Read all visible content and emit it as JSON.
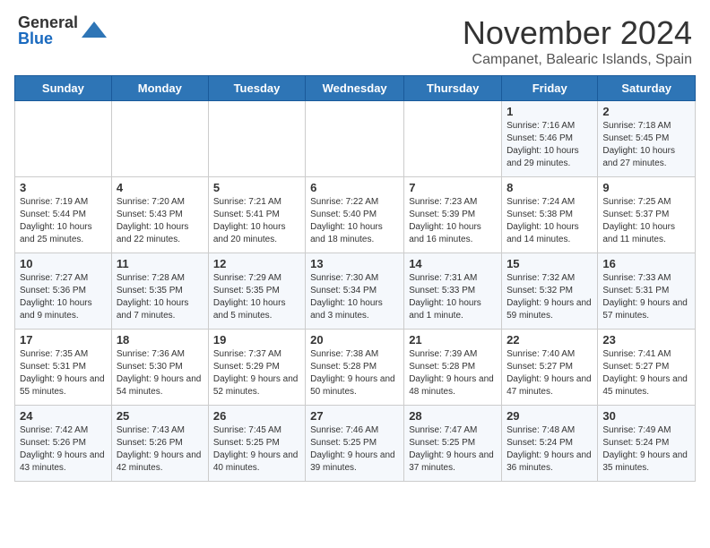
{
  "header": {
    "logo_general": "General",
    "logo_blue": "Blue",
    "month_title": "November 2024",
    "location": "Campanet, Balearic Islands, Spain"
  },
  "calendar": {
    "days_of_week": [
      "Sunday",
      "Monday",
      "Tuesday",
      "Wednesday",
      "Thursday",
      "Friday",
      "Saturday"
    ],
    "weeks": [
      [
        {
          "day": "",
          "info": ""
        },
        {
          "day": "",
          "info": ""
        },
        {
          "day": "",
          "info": ""
        },
        {
          "day": "",
          "info": ""
        },
        {
          "day": "",
          "info": ""
        },
        {
          "day": "1",
          "info": "Sunrise: 7:16 AM\nSunset: 5:46 PM\nDaylight: 10 hours and 29 minutes."
        },
        {
          "day": "2",
          "info": "Sunrise: 7:18 AM\nSunset: 5:45 PM\nDaylight: 10 hours and 27 minutes."
        }
      ],
      [
        {
          "day": "3",
          "info": "Sunrise: 7:19 AM\nSunset: 5:44 PM\nDaylight: 10 hours and 25 minutes."
        },
        {
          "day": "4",
          "info": "Sunrise: 7:20 AM\nSunset: 5:43 PM\nDaylight: 10 hours and 22 minutes."
        },
        {
          "day": "5",
          "info": "Sunrise: 7:21 AM\nSunset: 5:41 PM\nDaylight: 10 hours and 20 minutes."
        },
        {
          "day": "6",
          "info": "Sunrise: 7:22 AM\nSunset: 5:40 PM\nDaylight: 10 hours and 18 minutes."
        },
        {
          "day": "7",
          "info": "Sunrise: 7:23 AM\nSunset: 5:39 PM\nDaylight: 10 hours and 16 minutes."
        },
        {
          "day": "8",
          "info": "Sunrise: 7:24 AM\nSunset: 5:38 PM\nDaylight: 10 hours and 14 minutes."
        },
        {
          "day": "9",
          "info": "Sunrise: 7:25 AM\nSunset: 5:37 PM\nDaylight: 10 hours and 11 minutes."
        }
      ],
      [
        {
          "day": "10",
          "info": "Sunrise: 7:27 AM\nSunset: 5:36 PM\nDaylight: 10 hours and 9 minutes."
        },
        {
          "day": "11",
          "info": "Sunrise: 7:28 AM\nSunset: 5:35 PM\nDaylight: 10 hours and 7 minutes."
        },
        {
          "day": "12",
          "info": "Sunrise: 7:29 AM\nSunset: 5:35 PM\nDaylight: 10 hours and 5 minutes."
        },
        {
          "day": "13",
          "info": "Sunrise: 7:30 AM\nSunset: 5:34 PM\nDaylight: 10 hours and 3 minutes."
        },
        {
          "day": "14",
          "info": "Sunrise: 7:31 AM\nSunset: 5:33 PM\nDaylight: 10 hours and 1 minute."
        },
        {
          "day": "15",
          "info": "Sunrise: 7:32 AM\nSunset: 5:32 PM\nDaylight: 9 hours and 59 minutes."
        },
        {
          "day": "16",
          "info": "Sunrise: 7:33 AM\nSunset: 5:31 PM\nDaylight: 9 hours and 57 minutes."
        }
      ],
      [
        {
          "day": "17",
          "info": "Sunrise: 7:35 AM\nSunset: 5:31 PM\nDaylight: 9 hours and 55 minutes."
        },
        {
          "day": "18",
          "info": "Sunrise: 7:36 AM\nSunset: 5:30 PM\nDaylight: 9 hours and 54 minutes."
        },
        {
          "day": "19",
          "info": "Sunrise: 7:37 AM\nSunset: 5:29 PM\nDaylight: 9 hours and 52 minutes."
        },
        {
          "day": "20",
          "info": "Sunrise: 7:38 AM\nSunset: 5:28 PM\nDaylight: 9 hours and 50 minutes."
        },
        {
          "day": "21",
          "info": "Sunrise: 7:39 AM\nSunset: 5:28 PM\nDaylight: 9 hours and 48 minutes."
        },
        {
          "day": "22",
          "info": "Sunrise: 7:40 AM\nSunset: 5:27 PM\nDaylight: 9 hours and 47 minutes."
        },
        {
          "day": "23",
          "info": "Sunrise: 7:41 AM\nSunset: 5:27 PM\nDaylight: 9 hours and 45 minutes."
        }
      ],
      [
        {
          "day": "24",
          "info": "Sunrise: 7:42 AM\nSunset: 5:26 PM\nDaylight: 9 hours and 43 minutes."
        },
        {
          "day": "25",
          "info": "Sunrise: 7:43 AM\nSunset: 5:26 PM\nDaylight: 9 hours and 42 minutes."
        },
        {
          "day": "26",
          "info": "Sunrise: 7:45 AM\nSunset: 5:25 PM\nDaylight: 9 hours and 40 minutes."
        },
        {
          "day": "27",
          "info": "Sunrise: 7:46 AM\nSunset: 5:25 PM\nDaylight: 9 hours and 39 minutes."
        },
        {
          "day": "28",
          "info": "Sunrise: 7:47 AM\nSunset: 5:25 PM\nDaylight: 9 hours and 37 minutes."
        },
        {
          "day": "29",
          "info": "Sunrise: 7:48 AM\nSunset: 5:24 PM\nDaylight: 9 hours and 36 minutes."
        },
        {
          "day": "30",
          "info": "Sunrise: 7:49 AM\nSunset: 5:24 PM\nDaylight: 9 hours and 35 minutes."
        }
      ]
    ]
  }
}
